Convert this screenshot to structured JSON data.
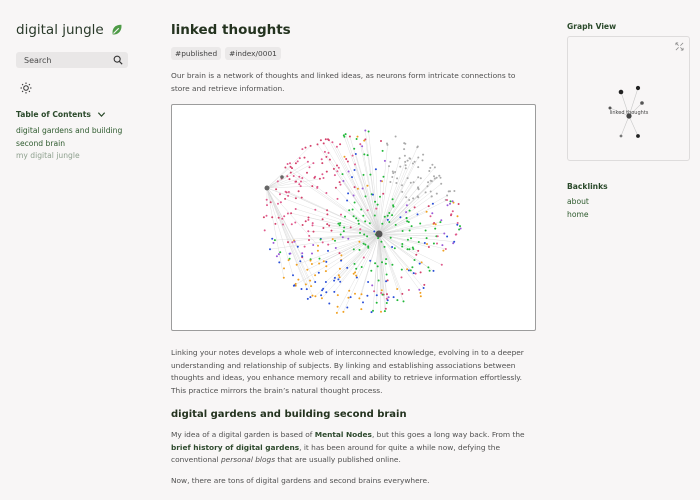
{
  "site": {
    "title": "digital jungle",
    "logo_icon": "leaf-icon",
    "brand_color": "#4e9b47"
  },
  "search": {
    "label": "Search",
    "icon": "search-icon"
  },
  "theme_toggle": {
    "icon": "sun-icon"
  },
  "toc": {
    "heading": "Table of Contents",
    "items": [
      {
        "label": "digital gardens and building",
        "dim": false
      },
      {
        "label": "second brain",
        "dim": false
      },
      {
        "label": "my digital jungle",
        "dim": true
      }
    ]
  },
  "article": {
    "title": "linked thoughts",
    "tags": [
      "#published",
      "#index/0001"
    ],
    "intro": "Our brain is a network of thoughts and linked ideas, as neurons form intricate connections to store and retrieve information.",
    "para2": "Linking your notes develops a whole web of interconnected knowledge, evolving in to a deeper understanding and relationship of subjects. By linking and establishing associations between thoughts and ideas, you enhance memory recall and ability to retrieve information effortlessly. This practice mirrors the brain’s natural thought process.",
    "section_heading": "digital gardens and building second brain",
    "para3": {
      "t1": "My idea of a digital garden is based of ",
      "b1": "Mental Nodes",
      "t2": ", but this goes a long way back. From the ",
      "b2": "brief history of digital gardens",
      "t3": ", it has been around for quite a while now, defying the conventional ",
      "i1": "personal blogs",
      "t4": " that are usually published online."
    },
    "para4": "Now, there are tons of digital gardens and second brains everywhere."
  },
  "graph_view": {
    "heading": "Graph View",
    "expand_icon": "expand-icon",
    "center_label": "linked thoughts"
  },
  "backlinks": {
    "heading": "Backlinks",
    "items": [
      "about",
      "home"
    ]
  }
}
